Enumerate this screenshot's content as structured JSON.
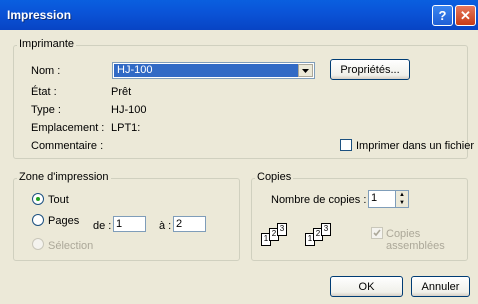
{
  "window": {
    "title": "Impression"
  },
  "printer": {
    "legend": "Imprimante",
    "name_label": "Nom :",
    "name_value": "HJ-100",
    "properties_label": "Propriétés...",
    "status_label": "État :",
    "status_value": "Prêt",
    "type_label": "Type :",
    "type_value": "HJ-100",
    "location_label": "Emplacement :",
    "location_value": "LPT1:",
    "comment_label": "Commentaire :",
    "print_to_file_label": "Imprimer dans un fichier"
  },
  "range": {
    "legend": "Zone d'impression",
    "all_label": "Tout",
    "pages_label": "Pages",
    "from_label": "de :",
    "from_value": "1",
    "to_label": "à :",
    "to_value": "2",
    "selection_label": "Sélection",
    "selected": "all"
  },
  "copies": {
    "legend": "Copies",
    "count_label": "Nombre de copies :",
    "count_value": "1",
    "collate_label": "Copies assemblées",
    "collate_checked": true,
    "collate_enabled": false
  },
  "buttons": {
    "ok_label": "OK",
    "cancel_label": "Annuler"
  }
}
